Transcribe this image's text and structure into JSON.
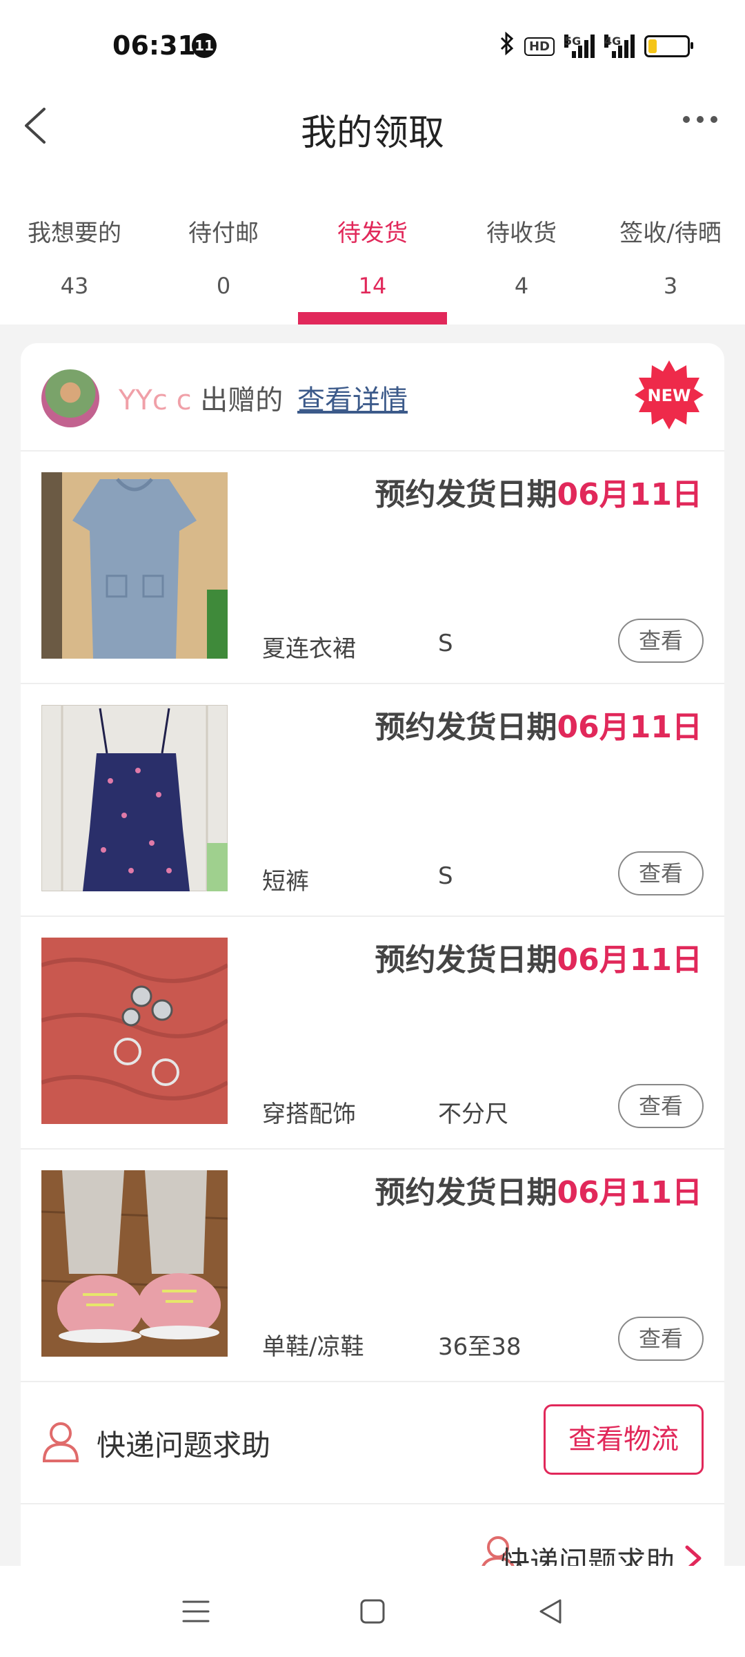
{
  "status_bar": {
    "time": "06:31",
    "notification_count": "11",
    "icons": [
      "bluetooth-icon",
      "hd-icon",
      "signal-5g-icon",
      "signal-4g-icon",
      "battery-icon"
    ],
    "hd_label": "HD",
    "sig1_label": "5G",
    "sig2_label": "4G"
  },
  "header": {
    "title": "我的领取",
    "back_icon": "back-icon",
    "more_icon": "more-icon"
  },
  "tabs": [
    {
      "label": "我想要的",
      "count": "43",
      "active": false
    },
    {
      "label": "待付邮",
      "count": "0",
      "active": false
    },
    {
      "label": "待发货",
      "count": "14",
      "active": true
    },
    {
      "label": "待收货",
      "count": "4",
      "active": false
    },
    {
      "label": "签收/待晒",
      "count": "3",
      "active": false
    }
  ],
  "order": {
    "giver_name": "YYc c",
    "giver_suffix": "出赠的",
    "detail_link": "查看详情",
    "new_badge": "NEW",
    "items": [
      {
        "date_prefix": "预约发货日期",
        "date": "06月11日",
        "category": "夏连衣裙",
        "size": "S",
        "view_label": "查看",
        "thumb": "blue-dress"
      },
      {
        "date_prefix": "预约发货日期",
        "date": "06月11日",
        "category": "短裤",
        "size": "S",
        "view_label": "查看",
        "thumb": "floral-romper"
      },
      {
        "date_prefix": "预约发货日期",
        "date": "06月11日",
        "category": "穿搭配饰",
        "size": "不分尺",
        "view_label": "查看",
        "thumb": "earrings"
      },
      {
        "date_prefix": "预约发货日期",
        "date": "06月11日",
        "category": "单鞋/凉鞋",
        "size": "36至38",
        "view_label": "查看",
        "thumb": "pink-sneakers"
      }
    ],
    "help_label": "快递问题求助",
    "logistics_label": "查看物流"
  },
  "bottom_help_label": "快递问题求助",
  "colors": {
    "accent": "#e1285a",
    "link": "#3c5a8a",
    "giver_name": "#f0a0a8"
  }
}
